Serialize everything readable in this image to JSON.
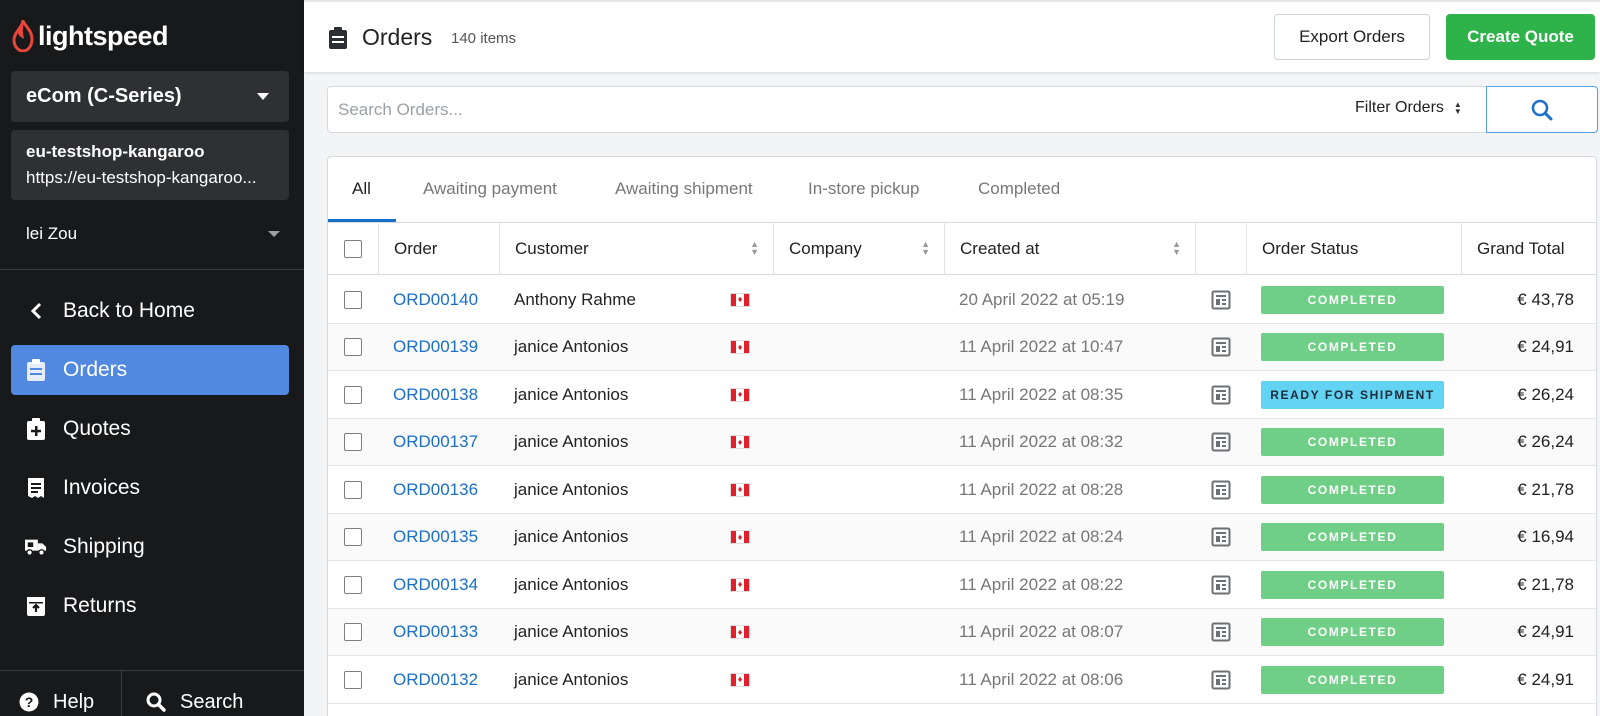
{
  "app": {
    "brand": "lightspeed",
    "shop_selector": "eCom (C-Series)",
    "shop_name": "eu-testshop-kangaroo",
    "shop_url": "https://eu-testshop-kangaroo...",
    "user": "lei Zou"
  },
  "sidebar": {
    "items": [
      {
        "label": "Back to Home",
        "icon": "chevron-left-icon"
      },
      {
        "label": "Orders",
        "icon": "clipboard-icon",
        "active": true
      },
      {
        "label": "Quotes",
        "icon": "clipboard-plus-icon"
      },
      {
        "label": "Invoices",
        "icon": "receipt-icon"
      },
      {
        "label": "Shipping",
        "icon": "truck-icon"
      },
      {
        "label": "Returns",
        "icon": "return-box-icon"
      }
    ],
    "bottom": {
      "help": "Help",
      "search": "Search"
    }
  },
  "header": {
    "title": "Orders",
    "count": "140 items",
    "export_label": "Export Orders",
    "create_label": "Create Quote"
  },
  "search": {
    "placeholder": "Search Orders...",
    "filter_label": "Filter Orders"
  },
  "tabs": [
    "All",
    "Awaiting payment",
    "Awaiting shipment",
    "In-store pickup",
    "Completed"
  ],
  "table": {
    "columns": [
      "Order",
      "Customer",
      "Company",
      "Created at",
      "",
      "Order Status",
      "Grand Total"
    ],
    "rows": [
      {
        "order": "ORD00140",
        "customer": "Anthony Rahme",
        "company": "",
        "created": "20 April 2022 at 05:19",
        "status": "COMPLETED",
        "total": "€ 43,78"
      },
      {
        "order": "ORD00139",
        "customer": "janice Antonios",
        "company": "",
        "created": "11 April 2022 at 10:47",
        "status": "COMPLETED",
        "total": "€ 24,91"
      },
      {
        "order": "ORD00138",
        "customer": "janice Antonios",
        "company": "",
        "created": "11 April 2022 at 08:35",
        "status": "READY FOR SHIPMENT",
        "total": "€ 26,24"
      },
      {
        "order": "ORD00137",
        "customer": "janice Antonios",
        "company": "",
        "created": "11 April 2022 at 08:32",
        "status": "COMPLETED",
        "total": "€ 26,24"
      },
      {
        "order": "ORD00136",
        "customer": "janice Antonios",
        "company": "",
        "created": "11 April 2022 at 08:28",
        "status": "COMPLETED",
        "total": "€ 21,78"
      },
      {
        "order": "ORD00135",
        "customer": "janice Antonios",
        "company": "",
        "created": "11 April 2022 at 08:24",
        "status": "COMPLETED",
        "total": "€ 16,94"
      },
      {
        "order": "ORD00134",
        "customer": "janice Antonios",
        "company": "",
        "created": "11 April 2022 at 08:22",
        "status": "COMPLETED",
        "total": "€ 21,78"
      },
      {
        "order": "ORD00133",
        "customer": "janice Antonios",
        "company": "",
        "created": "11 April 2022 at 08:07",
        "status": "COMPLETED",
        "total": "€ 24,91"
      },
      {
        "order": "ORD00132",
        "customer": "janice Antonios",
        "company": "",
        "created": "11 April 2022 at 08:06",
        "status": "COMPLETED",
        "total": "€ 24,91"
      }
    ]
  },
  "colors": {
    "sidebar_bg": "#18191b",
    "active_nav": "#5289e0",
    "primary_button": "#2eb34a",
    "link": "#1a6fc9",
    "status_completed": "#6fcf86",
    "status_ready": "#62d3f2"
  }
}
